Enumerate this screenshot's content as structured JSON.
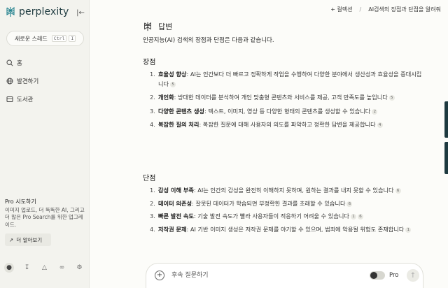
{
  "app": {
    "name": "perplexity",
    "brand_color": "#20808d"
  },
  "sidebar": {
    "new_thread": {
      "label": "새로운 스레드",
      "kbd1": "Ctrl",
      "kbd2": "I"
    },
    "items": [
      {
        "label": "홈",
        "icon": "search-icon"
      },
      {
        "label": "발견하기",
        "icon": "globe-icon"
      },
      {
        "label": "도서관",
        "icon": "library-icon"
      }
    ],
    "pro": {
      "title": "Pro 시도하기",
      "desc": "이미지 업로드, 더 똑똑한 AI, 그리고 더 많은 Pro Search를 위한 업그레이드.",
      "learn_more": "더 알아보기"
    },
    "bottom_icons": [
      "user-icon",
      "download-icon",
      "bell-icon",
      "feedback-icon",
      "settings-icon"
    ]
  },
  "header": {
    "new_label": "+ 컬렉션",
    "separator": "/",
    "thread_title": "AI검색의 장점과 단점을 알려줘"
  },
  "answer": {
    "heading": "답변",
    "intro": "인공지능(AI) 검색의 장점과 단점은 다음과 같습니다.",
    "pros_title": "장점",
    "pros": [
      {
        "num": "1.",
        "term": "효율성 향상",
        "text": ": AI는 인간보다 더 빠르고 정확하게 작업을 수행하여 다양한 분야에서 생산성과 효율성을 증대시킵니다",
        "cite": "5"
      },
      {
        "num": "2.",
        "term": "개인화",
        "text": ": 방대한 데이터를 분석하여 개인 맞춤형 콘텐츠와 서비스를 제공, 고객 만족도를 높입니다",
        "cite": "5"
      },
      {
        "num": "3.",
        "term": "다양한 콘텐츠 생성",
        "text": ": 텍스트, 이미지, 영상 등 다양한 형태의 콘텐츠를 생성할 수 있습니다",
        "cite": "2"
      },
      {
        "num": "4.",
        "term": "복잡한 질의 처리",
        "text": ": 복잡한 질문에 대해 사용자의 의도를 파악하고 정확한 답변을 제공합니다",
        "cite": "4"
      }
    ],
    "cons_title": "단점",
    "cons": [
      {
        "num": "1.",
        "term": "감성 이해 부족",
        "text": ": AI는 인간의 감성을 완전히 이해하지 못하며, 원하는 결과를 내지 못할 수 있습니다",
        "cite": "6"
      },
      {
        "num": "2.",
        "term": "데이터 의존성",
        "text": ": 잘못된 데이터가 학습되면 부정확한 결과를 초래할 수 있습니다",
        "cite": "6"
      },
      {
        "num": "3.",
        "term": "빠른 발전 속도",
        "text": ": 기술 발전 속도가 빨라 사용자들이 적응하기 어려울 수 있습니다",
        "cite": "1",
        "cite2": "6"
      },
      {
        "num": "4.",
        "term": "저작권 문제",
        "text": ": AI 기반 이미지 생성은 저작권 문제를 야기할 수 있으며, 범죄에 악용될 위험도 존재합니다",
        "cite": "1"
      }
    ]
  },
  "followup": {
    "placeholder": "후속 질문하기",
    "pro_label": "Pro"
  }
}
